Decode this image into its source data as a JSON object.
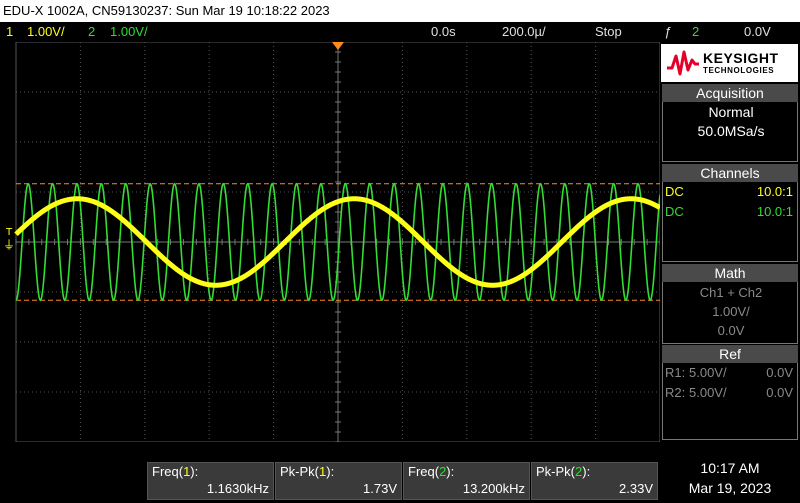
{
  "title_bar": {
    "text": "EDU-X 1002A, CN59130237: Sun Mar 19 10:18:22 2023"
  },
  "status": {
    "ch1_num": "1",
    "ch1_scale": "1.00V/",
    "ch2_num": "2",
    "ch2_scale": "1.00V/",
    "time_ref": "0.0s",
    "timebase": "200.0µ/",
    "run_state": "Stop",
    "trig_icon": "ƒ",
    "trig_source": "2",
    "trig_level": "0.0V"
  },
  "brand": {
    "name": "KEYSIGHT",
    "sub": "TECHNOLOGIES"
  },
  "acquisition": {
    "header": "Acquisition",
    "mode": "Normal",
    "rate": "50.0MSa/s"
  },
  "channels": {
    "header": "Channels",
    "rows": [
      {
        "coupling": "DC",
        "probe": "10.0:1"
      },
      {
        "coupling": "DC",
        "probe": "10.0:1"
      }
    ]
  },
  "math": {
    "header": "Math",
    "func": "Ch1 + Ch2",
    "scale": "1.00V/",
    "offset": "0.0V"
  },
  "ref": {
    "header": "Ref",
    "rows": [
      {
        "name": "R1:",
        "scale": "5.00V/",
        "offset": "0.0V"
      },
      {
        "name": "R2:",
        "scale": "5.00V/",
        "offset": "0.0V"
      }
    ]
  },
  "measurements": [
    {
      "label_pre": "Freq(",
      "ch": "1",
      "label_post": "):",
      "value": "1.1630kHz"
    },
    {
      "label_pre": "Pk-Pk(",
      "ch": "1",
      "label_post": "):",
      "value": "1.73V"
    },
    {
      "label_pre": "Freq(",
      "ch": "2",
      "label_post": "):",
      "value": "13.200kHz"
    },
    {
      "label_pre": "Pk-Pk(",
      "ch": "2",
      "label_post": "):",
      "value": "2.33V"
    }
  ],
  "clock": {
    "time": "10:17 AM",
    "date": "Mar 19, 2023"
  },
  "waveforms": {
    "ch1": {
      "color": "#ffff1a",
      "freq_hz": 1163.0,
      "vpp": 1.73
    },
    "ch2": {
      "color": "#33dd33",
      "freq_hz": 13200.0,
      "vpp": 2.33
    },
    "cursor_color": "#ff8c1a",
    "grid_color": "#555555",
    "trigger_marker_color": "#ff8c1a"
  }
}
